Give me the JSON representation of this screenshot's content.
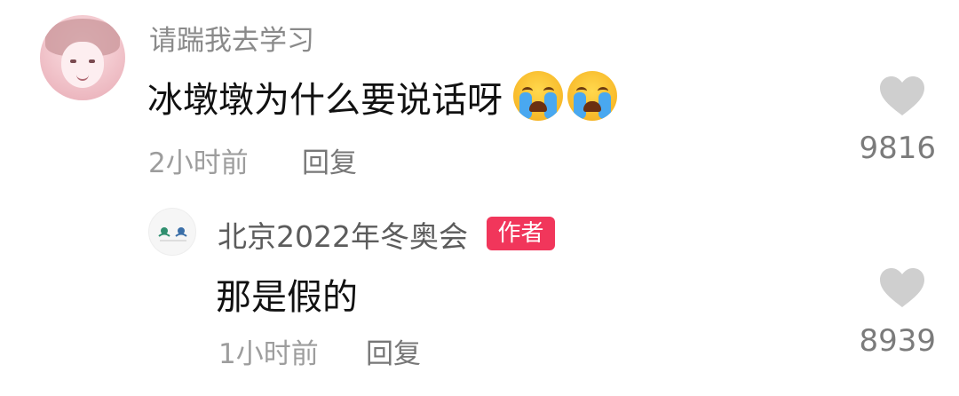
{
  "comment": {
    "username": "请踹我去学习",
    "text": "冰墩墩为什么要说话呀",
    "emojis": [
      "crying-face-emoji",
      "crying-face-emoji"
    ],
    "time": "2小时前",
    "reply_label": "回复",
    "like_count": "9816"
  },
  "reply": {
    "username": "北京2022年冬奥会",
    "author_badge": "作者",
    "text": "那是假的",
    "time": "1小时前",
    "reply_label": "回复",
    "like_count": "8939"
  },
  "colors": {
    "badge": "#f1365b",
    "secondary_text": "#9d9d9d",
    "heart": "#cfcfcf"
  }
}
